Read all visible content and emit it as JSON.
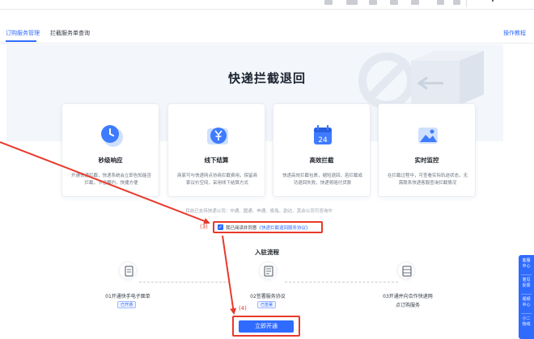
{
  "tabs": [
    {
      "label": "订购服务管理",
      "active": true
    },
    {
      "label": "拦截服务单查询",
      "active": false
    }
  ],
  "help_link": "操作教程",
  "hero": {
    "title": "快递拦截退回"
  },
  "features": [
    {
      "title": "秒级响应",
      "desc": "开通快递拦截，快递系统会立即告知能否拦截，节省履约，快捷方便",
      "icon": "clock-icon"
    },
    {
      "title": "线下结算",
      "desc": "商家可与快递网点协商拦截费用，保留商家议价空间，采用线下结算方式",
      "icon": "yen-icon"
    },
    {
      "title": "高效拦截",
      "desc": "快递高效拦截包裹，缩短退回，若拦截成功退回失败，快递将赔付货款",
      "icon": "calendar-icon"
    },
    {
      "title": "实时监控",
      "desc": "在拦截过程中，可查看实际轨迹状态，无需联系快递客服查询拦截情况",
      "icon": "image-icon"
    }
  ],
  "carriers_text": "目前已支持快递公司：中通、圆通、申通、极兔、韵达、其余公司可咨询中",
  "agreement": {
    "prefix": "我已阅读并同意",
    "link": "《快递拦截退回服务协议》",
    "checked": true
  },
  "annotations": {
    "step3": "(3)",
    "step4": "(4)"
  },
  "flow": {
    "title": "入驻流程",
    "steps": [
      {
        "label": "01开通快手电子面单",
        "status": "已开通",
        "icon": "document-icon"
      },
      {
        "label": "02签署服务协议",
        "status": "已签署",
        "icon": "contract-icon"
      },
      {
        "label": "03开通并向合作快递网点订购服务",
        "line1": "03开通并向合作快递网",
        "line2": "点订购服务",
        "status": "",
        "icon": "list-icon"
      }
    ]
  },
  "cta": {
    "label": "立即开通"
  },
  "float_panel": {
    "items": [
      {
        "line1": "客服",
        "line2": "中心"
      },
      {
        "line1": "意见",
        "line2": "反馈"
      },
      {
        "line1": "视频",
        "line2": "中心"
      },
      {
        "line1": "小二",
        "line2": "热线"
      }
    ]
  },
  "colors": {
    "primary": "#2f6bff",
    "annotation": "#e8392b",
    "hero_bg": "#f3f6fb"
  }
}
